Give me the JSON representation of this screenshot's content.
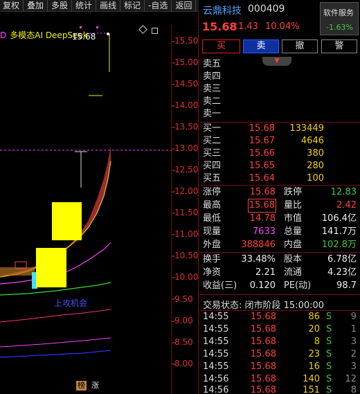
{
  "toolbar": {
    "items": [
      "复权",
      "叠加",
      "多股",
      "统计",
      "画线",
      "标记",
      "-自选",
      "返回"
    ]
  },
  "chart": {
    "ai_label_prefix": "D",
    "ai_label": "多模态AI DeepSeek",
    "high_marker": "15.68",
    "opportunity_label": "上攻机会",
    "tag_1": "榜",
    "tag_2": "涨",
    "yaxis": [
      "15.50",
      "15.00",
      "14.50",
      "14.00",
      "13.50",
      "13.00",
      "12.50",
      "12.00",
      "11.50",
      "11.00",
      "10.50",
      "10.00",
      "9.50",
      "9.00",
      "8.50",
      "8.00"
    ]
  },
  "stock": {
    "name": "云鼎科技",
    "code": "000409",
    "price": "15.68",
    "change": "1.43",
    "change_pct": "10.04%",
    "sector_label": "软件服务",
    "sector_pct": "-1.63%"
  },
  "actions": {
    "buy": "买",
    "sell": "卖",
    "cancel": "撤",
    "alert": "警"
  },
  "orderbook": {
    "asks": [
      {
        "label": "卖五",
        "price": "",
        "vol": ""
      },
      {
        "label": "卖四",
        "price": "",
        "vol": ""
      },
      {
        "label": "卖三",
        "price": "",
        "vol": ""
      },
      {
        "label": "卖二",
        "price": "",
        "vol": ""
      },
      {
        "label": "卖一",
        "price": "",
        "vol": ""
      }
    ],
    "bids": [
      {
        "label": "买一",
        "price": "15.68",
        "vol": "133449"
      },
      {
        "label": "买二",
        "price": "15.67",
        "vol": "4646"
      },
      {
        "label": "买三",
        "price": "15.66",
        "vol": "380"
      },
      {
        "label": "买四",
        "price": "15.65",
        "vol": "280"
      },
      {
        "label": "买五",
        "price": "15.64",
        "vol": "100"
      }
    ]
  },
  "stats": {
    "limit_up_k": "涨停",
    "limit_up_v": "15.68",
    "limit_down_k": "跌停",
    "limit_down_v": "12.83",
    "high_k": "最高",
    "high_v": "15.68",
    "vol_ratio_k": "量比",
    "vol_ratio_v": "2.42",
    "low_k": "最低",
    "low_v": "14.78",
    "mktcap_k": "市值",
    "mktcap_v": "106.4亿",
    "now_vol_k": "现量",
    "now_vol_v": "7633",
    "total_vol_k": "总量",
    "total_vol_v": "141.7万",
    "outer_k": "外盘",
    "outer_v": "388846",
    "inner_k": "内盘",
    "inner_v": "102.8万",
    "turnover_k": "换手",
    "turnover_v": "33.48%",
    "capital_k": "股本",
    "capital_v": "6.78亿",
    "nav_k": "净资",
    "nav_v": "2.21",
    "float_k": "流通",
    "float_v": "4.23亿",
    "eps_k": "收益(三)",
    "eps_v": "0.120",
    "pe_k": "PE(动)",
    "pe_v": "98.7"
  },
  "trade_status": "交易状态: 闭市阶段 15:00:00",
  "ticks": [
    {
      "time": "14:55",
      "price": "15.68",
      "qty": "86",
      "side": "S",
      "n": "9"
    },
    {
      "time": "14:55",
      "price": "15.68",
      "qty": "20",
      "side": "S",
      "n": "1"
    },
    {
      "time": "14:55",
      "price": "15.68",
      "qty": "8",
      "side": "S",
      "n": "3"
    },
    {
      "time": "14:55",
      "price": "15.68",
      "qty": "23",
      "side": "S",
      "n": "2"
    },
    {
      "time": "14:55",
      "price": "15.68",
      "qty": "16",
      "side": "S",
      "n": "3"
    },
    {
      "time": "14:56",
      "price": "15.68",
      "qty": "140",
      "side": "S",
      "n": "12"
    },
    {
      "time": "14:56",
      "price": "15.68",
      "qty": "151",
      "side": "S",
      "n": "8"
    }
  ]
}
